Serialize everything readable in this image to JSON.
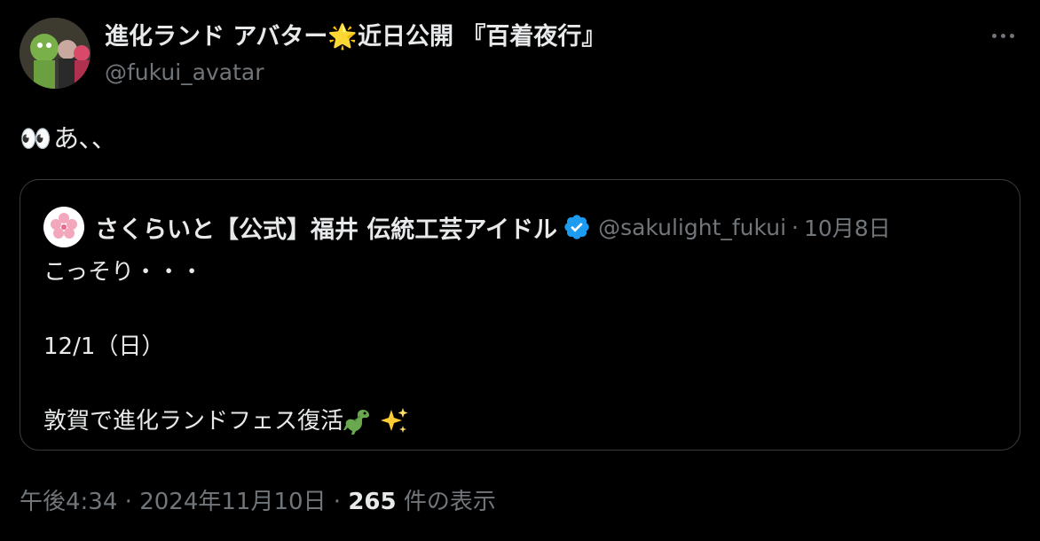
{
  "tweet": {
    "display_name": "進化ランド アバター🌟近日公開 『百着夜行』",
    "handle": "@fukui_avatar",
    "text": "あ､､",
    "eyes_emoji": "👀",
    "more_icon": "more-horizontal-icon"
  },
  "quote": {
    "display_name": "さくらいと【公式】福井 伝統工芸アイドル",
    "handle": "@sakulight_fukui",
    "separator": "·",
    "date": "10月8日",
    "lines": [
      "こっそり・・・",
      "12/1（日）",
      "敦賀で進化ランドフェス復活"
    ],
    "verified_color": "#1d9bf0"
  },
  "meta": {
    "time": "午後4:34",
    "separator": "·",
    "date": "2024年11月10日",
    "views_count": "265",
    "views_label": "件の表示"
  }
}
